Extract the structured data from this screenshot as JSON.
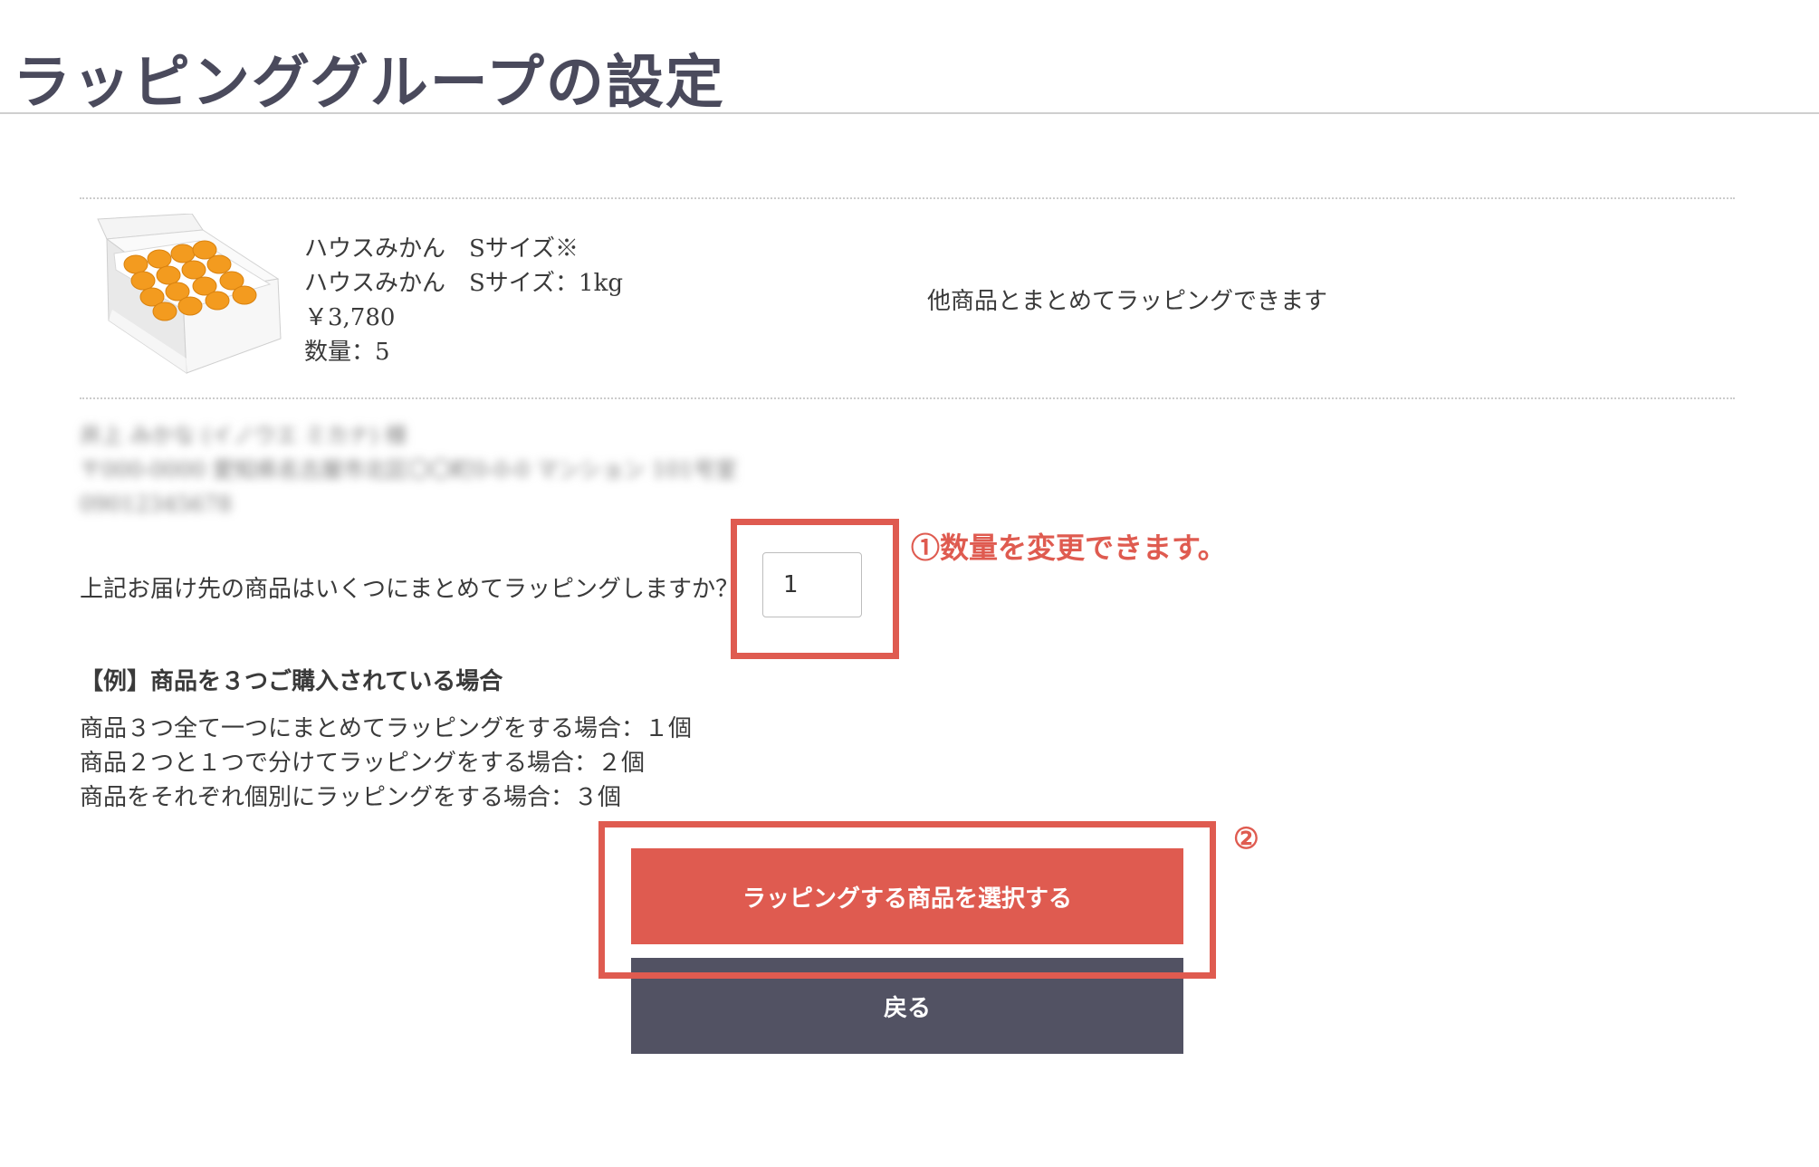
{
  "page": {
    "title": "ラッピンググループの設定"
  },
  "product": {
    "name": "ハウスみかん　Sサイズ※",
    "variant": "ハウスみかん　Sサイズ：1kg",
    "price": "￥3,780",
    "quantity": "数量：5",
    "wrap_note": "他商品とまとめてラッピングできます"
  },
  "address": {
    "line1": "井上 みかな (イノウエ ミカナ) 様",
    "line2": "〒000-0000 愛知県名古屋市北区〇〇町0-0-0 マンション 101号室",
    "line3": "09012345678"
  },
  "group": {
    "question": "上記お届け先の商品はいくつにまとめてラッピングしますか？",
    "value": "1"
  },
  "example": {
    "heading": "【例】商品を３つご購入されている場合",
    "lines": [
      "商品３つ全て一つにまとめてラッピングをする場合：１個",
      "商品２つと１つで分けてラッピングをする場合：２個",
      "商品をそれぞれ個別にラッピングをする場合：３個"
    ]
  },
  "buttons": {
    "select_label": "ラッピングする商品を選択する",
    "back_label": "戻る"
  },
  "annotations": {
    "note1": "①数量を変更できます。",
    "note2": "②"
  },
  "colors": {
    "accent": "#df5b50",
    "dark_button": "#525263",
    "title": "#4a4a5c",
    "fruit": "#f39b1f"
  }
}
